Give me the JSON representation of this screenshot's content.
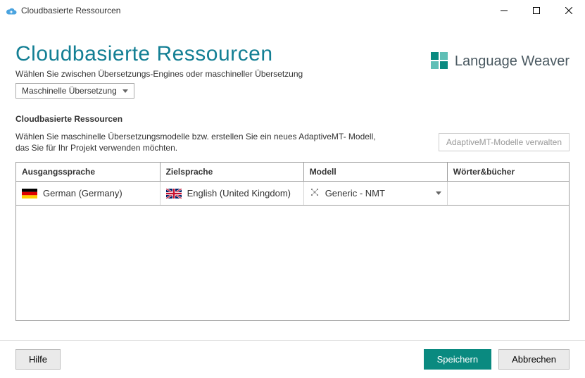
{
  "window": {
    "title": "Cloudbasierte Ressourcen"
  },
  "page": {
    "title": "Cloudbasierte Ressourcen",
    "subtitle": "Wählen Sie zwischen Übersetzungs-Engines oder maschineller Übersetzung"
  },
  "brand": {
    "name": "Language Weaver"
  },
  "selector": {
    "value": "Maschinelle Übersetzung"
  },
  "section": {
    "label": "Cloudbasierte Ressourcen",
    "description": "Wählen Sie maschinelle Übersetzungsmodelle bzw. erstellen Sie ein neues AdaptiveMT- Modell, das Sie für Ihr Projekt verwenden möchten.",
    "manage_button": "AdaptiveMT-Modelle verwalten"
  },
  "table": {
    "headers": {
      "source": "Ausgangssprache",
      "target": "Zielsprache",
      "model": "Modell",
      "dictionaries": "Wörter&bücher"
    },
    "row": {
      "source": "German (Germany)",
      "target": "English (United Kingdom)",
      "model": "Generic - NMT",
      "dictionaries": ""
    }
  },
  "footer": {
    "help": "Hilfe",
    "save": "Speichern",
    "cancel": "Abbrechen"
  }
}
